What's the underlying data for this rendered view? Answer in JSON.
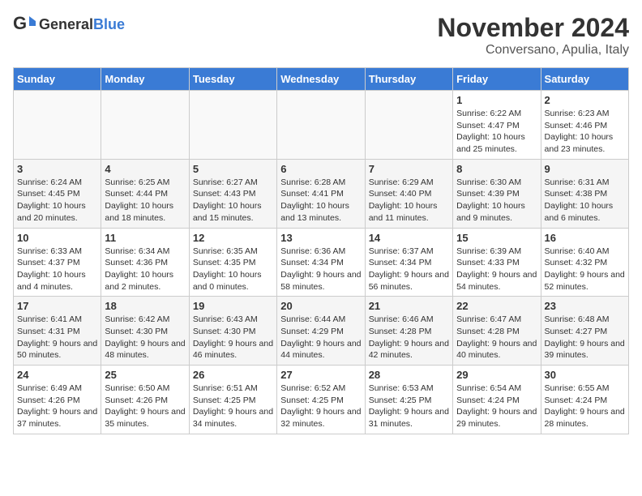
{
  "logo": {
    "text_general": "General",
    "text_blue": "Blue"
  },
  "header": {
    "month": "November 2024",
    "location": "Conversano, Apulia, Italy"
  },
  "days_of_week": [
    "Sunday",
    "Monday",
    "Tuesday",
    "Wednesday",
    "Thursday",
    "Friday",
    "Saturday"
  ],
  "weeks": [
    [
      {
        "day": "",
        "info": ""
      },
      {
        "day": "",
        "info": ""
      },
      {
        "day": "",
        "info": ""
      },
      {
        "day": "",
        "info": ""
      },
      {
        "day": "",
        "info": ""
      },
      {
        "day": "1",
        "info": "Sunrise: 6:22 AM\nSunset: 4:47 PM\nDaylight: 10 hours and 25 minutes."
      },
      {
        "day": "2",
        "info": "Sunrise: 6:23 AM\nSunset: 4:46 PM\nDaylight: 10 hours and 23 minutes."
      }
    ],
    [
      {
        "day": "3",
        "info": "Sunrise: 6:24 AM\nSunset: 4:45 PM\nDaylight: 10 hours and 20 minutes."
      },
      {
        "day": "4",
        "info": "Sunrise: 6:25 AM\nSunset: 4:44 PM\nDaylight: 10 hours and 18 minutes."
      },
      {
        "day": "5",
        "info": "Sunrise: 6:27 AM\nSunset: 4:43 PM\nDaylight: 10 hours and 15 minutes."
      },
      {
        "day": "6",
        "info": "Sunrise: 6:28 AM\nSunset: 4:41 PM\nDaylight: 10 hours and 13 minutes."
      },
      {
        "day": "7",
        "info": "Sunrise: 6:29 AM\nSunset: 4:40 PM\nDaylight: 10 hours and 11 minutes."
      },
      {
        "day": "8",
        "info": "Sunrise: 6:30 AM\nSunset: 4:39 PM\nDaylight: 10 hours and 9 minutes."
      },
      {
        "day": "9",
        "info": "Sunrise: 6:31 AM\nSunset: 4:38 PM\nDaylight: 10 hours and 6 minutes."
      }
    ],
    [
      {
        "day": "10",
        "info": "Sunrise: 6:33 AM\nSunset: 4:37 PM\nDaylight: 10 hours and 4 minutes."
      },
      {
        "day": "11",
        "info": "Sunrise: 6:34 AM\nSunset: 4:36 PM\nDaylight: 10 hours and 2 minutes."
      },
      {
        "day": "12",
        "info": "Sunrise: 6:35 AM\nSunset: 4:35 PM\nDaylight: 10 hours and 0 minutes."
      },
      {
        "day": "13",
        "info": "Sunrise: 6:36 AM\nSunset: 4:34 PM\nDaylight: 9 hours and 58 minutes."
      },
      {
        "day": "14",
        "info": "Sunrise: 6:37 AM\nSunset: 4:34 PM\nDaylight: 9 hours and 56 minutes."
      },
      {
        "day": "15",
        "info": "Sunrise: 6:39 AM\nSunset: 4:33 PM\nDaylight: 9 hours and 54 minutes."
      },
      {
        "day": "16",
        "info": "Sunrise: 6:40 AM\nSunset: 4:32 PM\nDaylight: 9 hours and 52 minutes."
      }
    ],
    [
      {
        "day": "17",
        "info": "Sunrise: 6:41 AM\nSunset: 4:31 PM\nDaylight: 9 hours and 50 minutes."
      },
      {
        "day": "18",
        "info": "Sunrise: 6:42 AM\nSunset: 4:30 PM\nDaylight: 9 hours and 48 minutes."
      },
      {
        "day": "19",
        "info": "Sunrise: 6:43 AM\nSunset: 4:30 PM\nDaylight: 9 hours and 46 minutes."
      },
      {
        "day": "20",
        "info": "Sunrise: 6:44 AM\nSunset: 4:29 PM\nDaylight: 9 hours and 44 minutes."
      },
      {
        "day": "21",
        "info": "Sunrise: 6:46 AM\nSunset: 4:28 PM\nDaylight: 9 hours and 42 minutes."
      },
      {
        "day": "22",
        "info": "Sunrise: 6:47 AM\nSunset: 4:28 PM\nDaylight: 9 hours and 40 minutes."
      },
      {
        "day": "23",
        "info": "Sunrise: 6:48 AM\nSunset: 4:27 PM\nDaylight: 9 hours and 39 minutes."
      }
    ],
    [
      {
        "day": "24",
        "info": "Sunrise: 6:49 AM\nSunset: 4:26 PM\nDaylight: 9 hours and 37 minutes."
      },
      {
        "day": "25",
        "info": "Sunrise: 6:50 AM\nSunset: 4:26 PM\nDaylight: 9 hours and 35 minutes."
      },
      {
        "day": "26",
        "info": "Sunrise: 6:51 AM\nSunset: 4:25 PM\nDaylight: 9 hours and 34 minutes."
      },
      {
        "day": "27",
        "info": "Sunrise: 6:52 AM\nSunset: 4:25 PM\nDaylight: 9 hours and 32 minutes."
      },
      {
        "day": "28",
        "info": "Sunrise: 6:53 AM\nSunset: 4:25 PM\nDaylight: 9 hours and 31 minutes."
      },
      {
        "day": "29",
        "info": "Sunrise: 6:54 AM\nSunset: 4:24 PM\nDaylight: 9 hours and 29 minutes."
      },
      {
        "day": "30",
        "info": "Sunrise: 6:55 AM\nSunset: 4:24 PM\nDaylight: 9 hours and 28 minutes."
      }
    ]
  ]
}
